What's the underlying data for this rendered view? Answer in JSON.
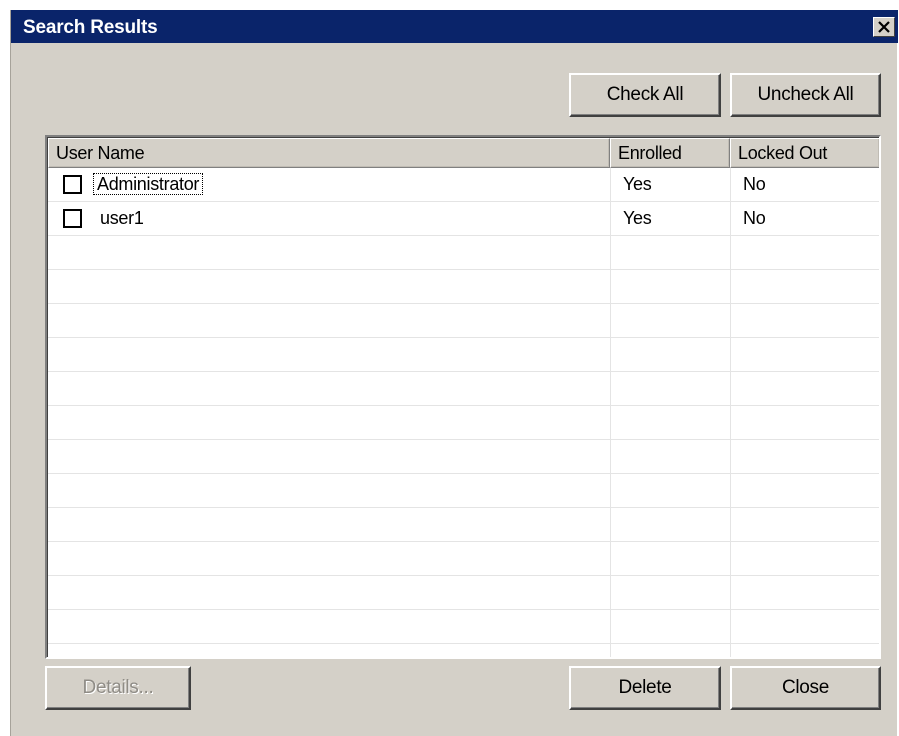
{
  "window": {
    "title": "Search Results",
    "close_symbol": "✕"
  },
  "toolbar": {
    "check_all_label": "Check All",
    "uncheck_all_label": "Uncheck All"
  },
  "table": {
    "columns": [
      "User Name",
      "Enrolled",
      "Locked Out"
    ],
    "rows": [
      {
        "checked": false,
        "user_name": "Administrator",
        "enrolled": "Yes",
        "locked_out": "No"
      },
      {
        "checked": false,
        "user_name": "user1",
        "enrolled": "Yes",
        "locked_out": "No"
      }
    ],
    "empty_row_count": 12
  },
  "footer": {
    "details_label": "Details...",
    "delete_label": "Delete",
    "close_label": "Close"
  }
}
